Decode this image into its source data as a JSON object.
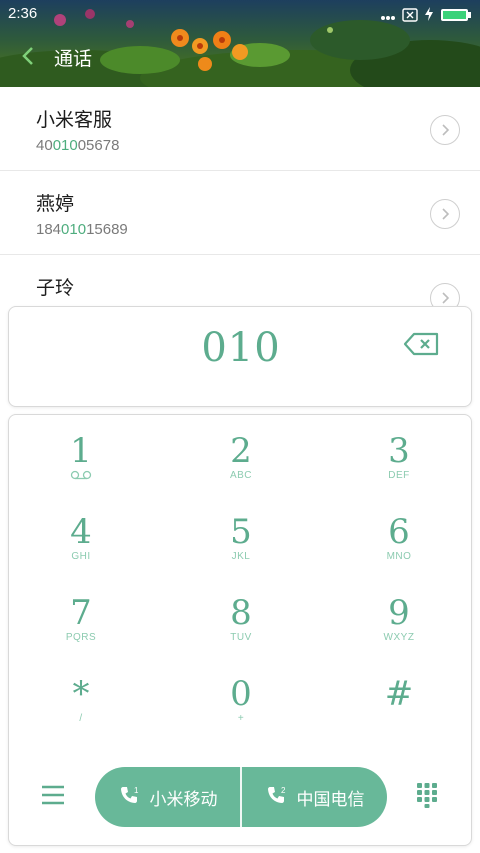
{
  "status_bar": {
    "time": "2:36"
  },
  "header": {
    "title": "通话"
  },
  "contacts": [
    {
      "name": "小米客服",
      "number_pre": "40",
      "number_match": "010",
      "number_post": "05678"
    },
    {
      "name": "燕婷",
      "number_pre": "184",
      "number_match": "010",
      "number_post": "15689"
    },
    {
      "name": "子玲",
      "number_pre": "",
      "number_match": "",
      "number_post": ""
    }
  ],
  "dialer": {
    "input": "010"
  },
  "keypad": [
    {
      "digit": "1",
      "letters": ""
    },
    {
      "digit": "2",
      "letters": "ABC"
    },
    {
      "digit": "3",
      "letters": "DEF"
    },
    {
      "digit": "4",
      "letters": "GHI"
    },
    {
      "digit": "5",
      "letters": "JKL"
    },
    {
      "digit": "6",
      "letters": "MNO"
    },
    {
      "digit": "7",
      "letters": "PQRS"
    },
    {
      "digit": "8",
      "letters": "TUV"
    },
    {
      "digit": "9",
      "letters": "WXYZ"
    },
    {
      "digit": "*",
      "letters": "/"
    },
    {
      "digit": "0",
      "letters": "+"
    },
    {
      "digit": "#",
      "letters": ""
    }
  ],
  "call_buttons": {
    "sim1": {
      "slot": "1",
      "label": "小米移动"
    },
    "sim2": {
      "slot": "2",
      "label": "中国电信"
    }
  },
  "colors": {
    "accent": "#5dac8e",
    "call_button": "#68b899",
    "highlight": "#4ead7e"
  },
  "icons": [
    "back-arrow-icon",
    "wifi-icon",
    "sim-x-icon",
    "charging-icon",
    "battery-icon",
    "chevron-right-icon",
    "backspace-icon",
    "voicemail-icon",
    "menu-icon",
    "phone-icon",
    "dialpad-icon"
  ]
}
